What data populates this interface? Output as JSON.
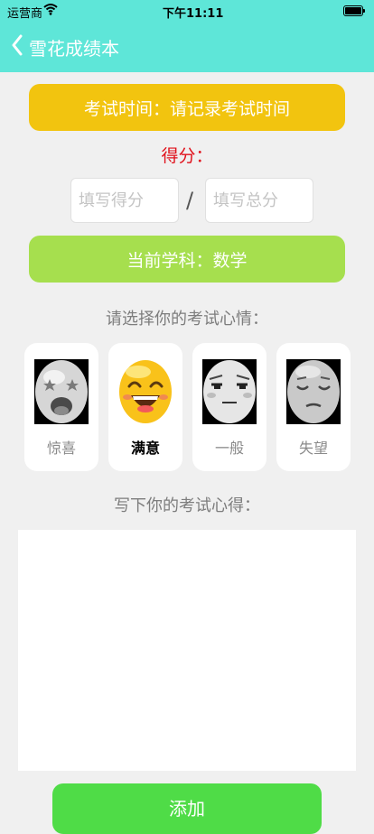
{
  "status_bar": {
    "carrier": "运营商",
    "time": "下午11:11"
  },
  "nav": {
    "title": "雪花成绩本"
  },
  "exam_time": {
    "label": "考试时间：请记录考试时间"
  },
  "score": {
    "label": "得分：",
    "score_placeholder": "填写得分",
    "separator": "/",
    "total_placeholder": "填写总分"
  },
  "subject": {
    "label": "当前学科：数学"
  },
  "mood": {
    "heading": "请选择你的考试心情：",
    "options": [
      {
        "label": "惊喜",
        "icon": "surprised-face-icon",
        "selected": false
      },
      {
        "label": "满意",
        "icon": "satisfied-face-icon",
        "selected": true
      },
      {
        "label": "一般",
        "icon": "neutral-face-icon",
        "selected": false
      },
      {
        "label": "失望",
        "icon": "disappointed-face-icon",
        "selected": false
      }
    ]
  },
  "reflection": {
    "heading": "写下你的考试心得："
  },
  "add_button": {
    "label": "添加"
  },
  "colors": {
    "header": "#5ee6d8",
    "exam_time_button": "#f2c40f",
    "subject_button": "#a6df4e",
    "add_button": "#4fdc47",
    "score_label": "#e0111b"
  }
}
